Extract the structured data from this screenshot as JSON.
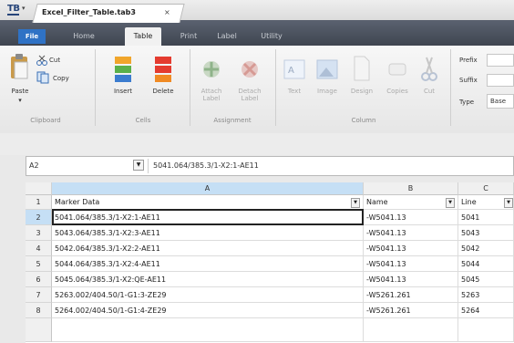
{
  "app": {
    "logo": "TB",
    "qa_arrow": "▾"
  },
  "ribbon_tabs": [
    "File",
    "Home",
    "Table",
    "Print",
    "Label",
    "Utility"
  ],
  "clipboard": {
    "paste": "Paste",
    "cut": "Cut",
    "copy": "Copy",
    "group": "Clipboard"
  },
  "cells": {
    "insert": "Insert",
    "delete": "Delete",
    "group": "Cells"
  },
  "assignment": {
    "attach": "Attach\nLabel",
    "detach": "Detach\nLabel",
    "group": "Assignment"
  },
  "column": {
    "text": "Text",
    "image": "Image",
    "design": "Design",
    "copies": "Copies",
    "cut": "Cut",
    "group": "Column"
  },
  "affix": {
    "prefix": "Prefix",
    "suffix": "Suffix",
    "type": "Type",
    "type_value": "Base"
  },
  "document_tab": {
    "label": "Excel_Filter_Table.tab3",
    "close": "×"
  },
  "namebox": {
    "value": "A2",
    "dropdown": "▼"
  },
  "formula_bar": {
    "value": "5041.064/385.3/1-X2:1-AE11"
  },
  "columns": [
    "A",
    "B",
    "C"
  ],
  "header_row": {
    "num": "1",
    "a": "Marker Data",
    "b": "Name",
    "c": "Line"
  },
  "filter_arrow": "▼",
  "rows": [
    {
      "num": "2",
      "a": "5041.064/385.3/1-X2:1-AE11",
      "b": "-W5041.13",
      "c": "5041"
    },
    {
      "num": "3",
      "a": "5043.064/385.3/1-X2:3-AE11",
      "b": "-W5041.13",
      "c": "5043"
    },
    {
      "num": "4",
      "a": "5042.064/385.3/1-X2:2-AE11",
      "b": "-W5041.13",
      "c": "5042"
    },
    {
      "num": "5",
      "a": "5044.064/385.3/1-X2:4-AE11",
      "b": "-W5041.13",
      "c": "5044"
    },
    {
      "num": "6",
      "a": "5045.064/385.3/1-X2:QE-AE11",
      "b": "-W5041.13",
      "c": "5045"
    },
    {
      "num": "7",
      "a": "5263.002/404.50/1-G1:3-ZE29",
      "b": "-W5261.261",
      "c": "5263"
    },
    {
      "num": "8",
      "a": "5264.002/404.50/1-G1:4-ZE29",
      "b": "-W5261.261",
      "c": "5264"
    }
  ],
  "colors": {
    "file_tab": "#2f72c5",
    "tab_strip": "#4b515c",
    "col_a_header": "#c5dff5",
    "selected_row": "#c5dff5"
  }
}
